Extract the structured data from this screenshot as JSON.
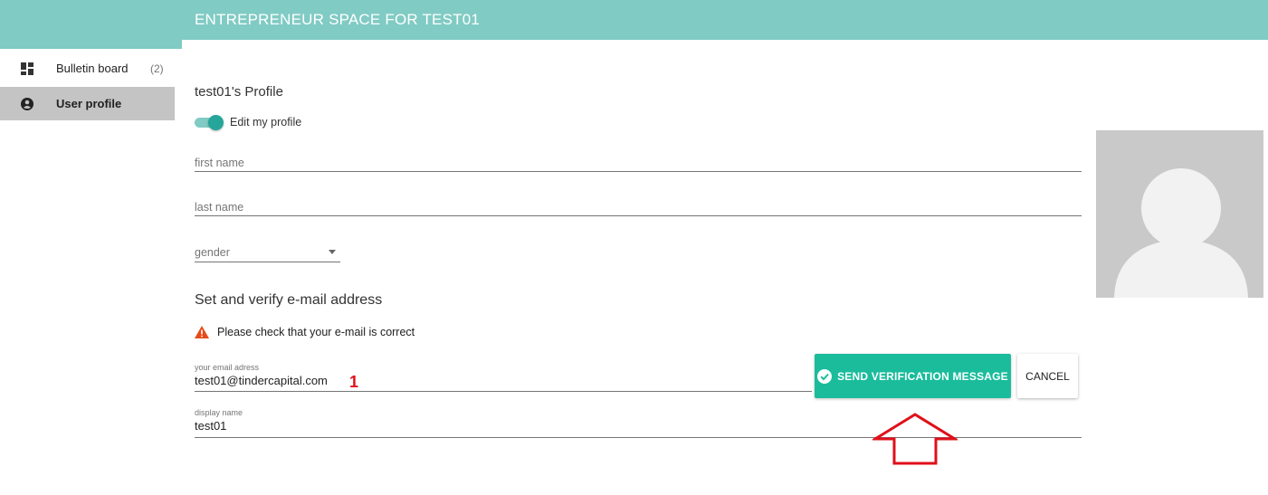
{
  "header": {
    "title": "ENTREPRENEUR SPACE FOR TEST01"
  },
  "sidebar": {
    "items": [
      {
        "label": "Bulletin board",
        "count": "(2)",
        "icon": "dashboard-icon"
      },
      {
        "label": "User profile",
        "icon": "account-circle-icon"
      }
    ]
  },
  "profile": {
    "title": "test01's Profile",
    "edit_toggle_label": "Edit my profile",
    "edit_toggle_on": true,
    "first_name_placeholder": "first name",
    "last_name_placeholder": "last name",
    "gender_placeholder": "gender"
  },
  "email_section": {
    "title": "Set and verify e-mail address",
    "warning": "Please check that your e-mail is correct",
    "email_label": "your email adress",
    "email_value": "test01@tindercapital.com",
    "display_name_label": "display name",
    "display_name_value": "test01",
    "send_button": "SEND VERIFICATION MESSAGE",
    "cancel_button": "CANCEL"
  },
  "annotation": {
    "number": "1"
  },
  "colors": {
    "header": "#80cbc4",
    "accent": "#1abc9c",
    "warning": "#e64a19",
    "annotation": "#e0101a"
  }
}
